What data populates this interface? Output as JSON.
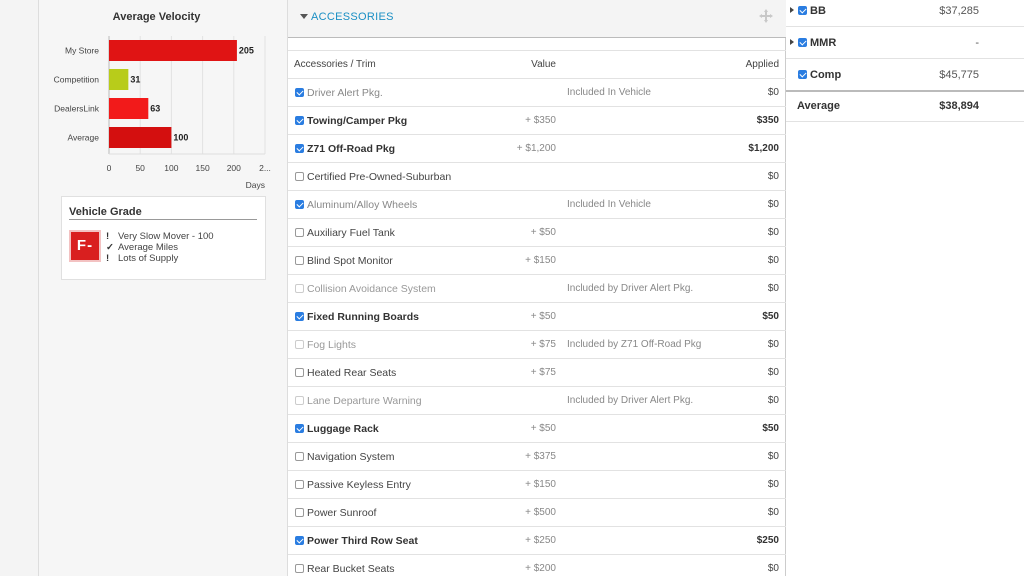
{
  "velocity": {
    "title": "Average Velocity",
    "chart_data": {
      "type": "bar",
      "orientation": "horizontal",
      "title": "Average Velocity",
      "categories": [
        "My Store",
        "Competition",
        "DealersLink",
        "Average"
      ],
      "values": [
        205,
        31,
        63,
        100
      ],
      "bar_colors": [
        "#e01414",
        "#b8cc1a",
        "#f21a1a",
        "#d40f0f"
      ],
      "xlabel": "Days",
      "xlim": [
        0,
        250
      ],
      "xticks": [
        "0",
        "50",
        "100",
        "150",
        "200",
        "2..."
      ],
      "grid": true
    }
  },
  "grade": {
    "title": "Vehicle Grade",
    "badge": "F-",
    "badge_color": "#d91f1f",
    "items": [
      {
        "icon": "!",
        "icon_name": "exclamation-icon",
        "text": "Very Slow Mover - 100"
      },
      {
        "icon": "✓",
        "icon_name": "check-icon",
        "text": "Average Miles"
      },
      {
        "icon": "!",
        "icon_name": "exclamation-icon",
        "text": "Lots of Supply"
      }
    ]
  },
  "accessories": {
    "section_title": "ACCESSORIES",
    "accent_color": "#1a8fc4",
    "headers": {
      "name": "Accessories / Trim",
      "value": "Value",
      "applied": "Applied"
    },
    "rows": [
      {
        "name": "Driver Alert Pkg.",
        "value": "",
        "note": "Included In Vehicle",
        "applied": "$0",
        "checked": true,
        "style": "incl"
      },
      {
        "name": "Towing/Camper Pkg",
        "value": "+ $350",
        "note": "",
        "applied": "$350",
        "checked": true,
        "style": "bold"
      },
      {
        "name": "Z71 Off-Road Pkg",
        "value": "+ $1,200",
        "note": "",
        "applied": "$1,200",
        "checked": true,
        "style": "bold"
      },
      {
        "name": "Certified Pre-Owned-Suburban",
        "value": "",
        "note": "",
        "applied": "$0",
        "checked": false,
        "style": "normal"
      },
      {
        "name": "Aluminum/Alloy Wheels",
        "value": "",
        "note": "Included In Vehicle",
        "applied": "$0",
        "checked": true,
        "style": "incl"
      },
      {
        "name": "Auxiliary Fuel Tank",
        "value": "+ $50",
        "note": "",
        "applied": "$0",
        "checked": false,
        "style": "normal"
      },
      {
        "name": "Blind Spot Monitor",
        "value": "+ $150",
        "note": "",
        "applied": "$0",
        "checked": false,
        "style": "normal"
      },
      {
        "name": "Collision Avoidance System",
        "value": "",
        "note": "Included by Driver Alert Pkg.",
        "applied": "$0",
        "checked": false,
        "style": "dim"
      },
      {
        "name": "Fixed Running Boards",
        "value": "+ $50",
        "note": "",
        "applied": "$50",
        "checked": true,
        "style": "bold"
      },
      {
        "name": "Fog Lights",
        "value": "+ $75",
        "note": "Included by Z71 Off-Road Pkg",
        "applied": "$0",
        "checked": false,
        "style": "dim"
      },
      {
        "name": "Heated Rear Seats",
        "value": "+ $75",
        "note": "",
        "applied": "$0",
        "checked": false,
        "style": "normal"
      },
      {
        "name": "Lane Departure Warning",
        "value": "",
        "note": "Included by Driver Alert Pkg.",
        "applied": "$0",
        "checked": false,
        "style": "dim"
      },
      {
        "name": "Luggage Rack",
        "value": "+ $50",
        "note": "",
        "applied": "$50",
        "checked": true,
        "style": "bold"
      },
      {
        "name": "Navigation System",
        "value": "+ $375",
        "note": "",
        "applied": "$0",
        "checked": false,
        "style": "normal"
      },
      {
        "name": "Passive Keyless Entry",
        "value": "+ $150",
        "note": "",
        "applied": "$0",
        "checked": false,
        "style": "normal"
      },
      {
        "name": "Power Sunroof",
        "value": "+ $500",
        "note": "",
        "applied": "$0",
        "checked": false,
        "style": "normal"
      },
      {
        "name": "Power Third Row Seat",
        "value": "+ $250",
        "note": "",
        "applied": "$250",
        "checked": true,
        "style": "bold"
      },
      {
        "name": "Rear Bucket Seats",
        "value": "+ $200",
        "note": "",
        "applied": "$0",
        "checked": false,
        "style": "normal"
      }
    ]
  },
  "valuations": {
    "rows": [
      {
        "label": "BB",
        "amount": "$37,285",
        "expandable": true,
        "checked": true
      },
      {
        "label": "MMR",
        "amount": "-",
        "expandable": true,
        "checked": true
      },
      {
        "label": "Comp",
        "amount": "$45,775",
        "expandable": false,
        "checked": true
      }
    ],
    "average_label": "Average",
    "average_amount": "$38,894"
  }
}
